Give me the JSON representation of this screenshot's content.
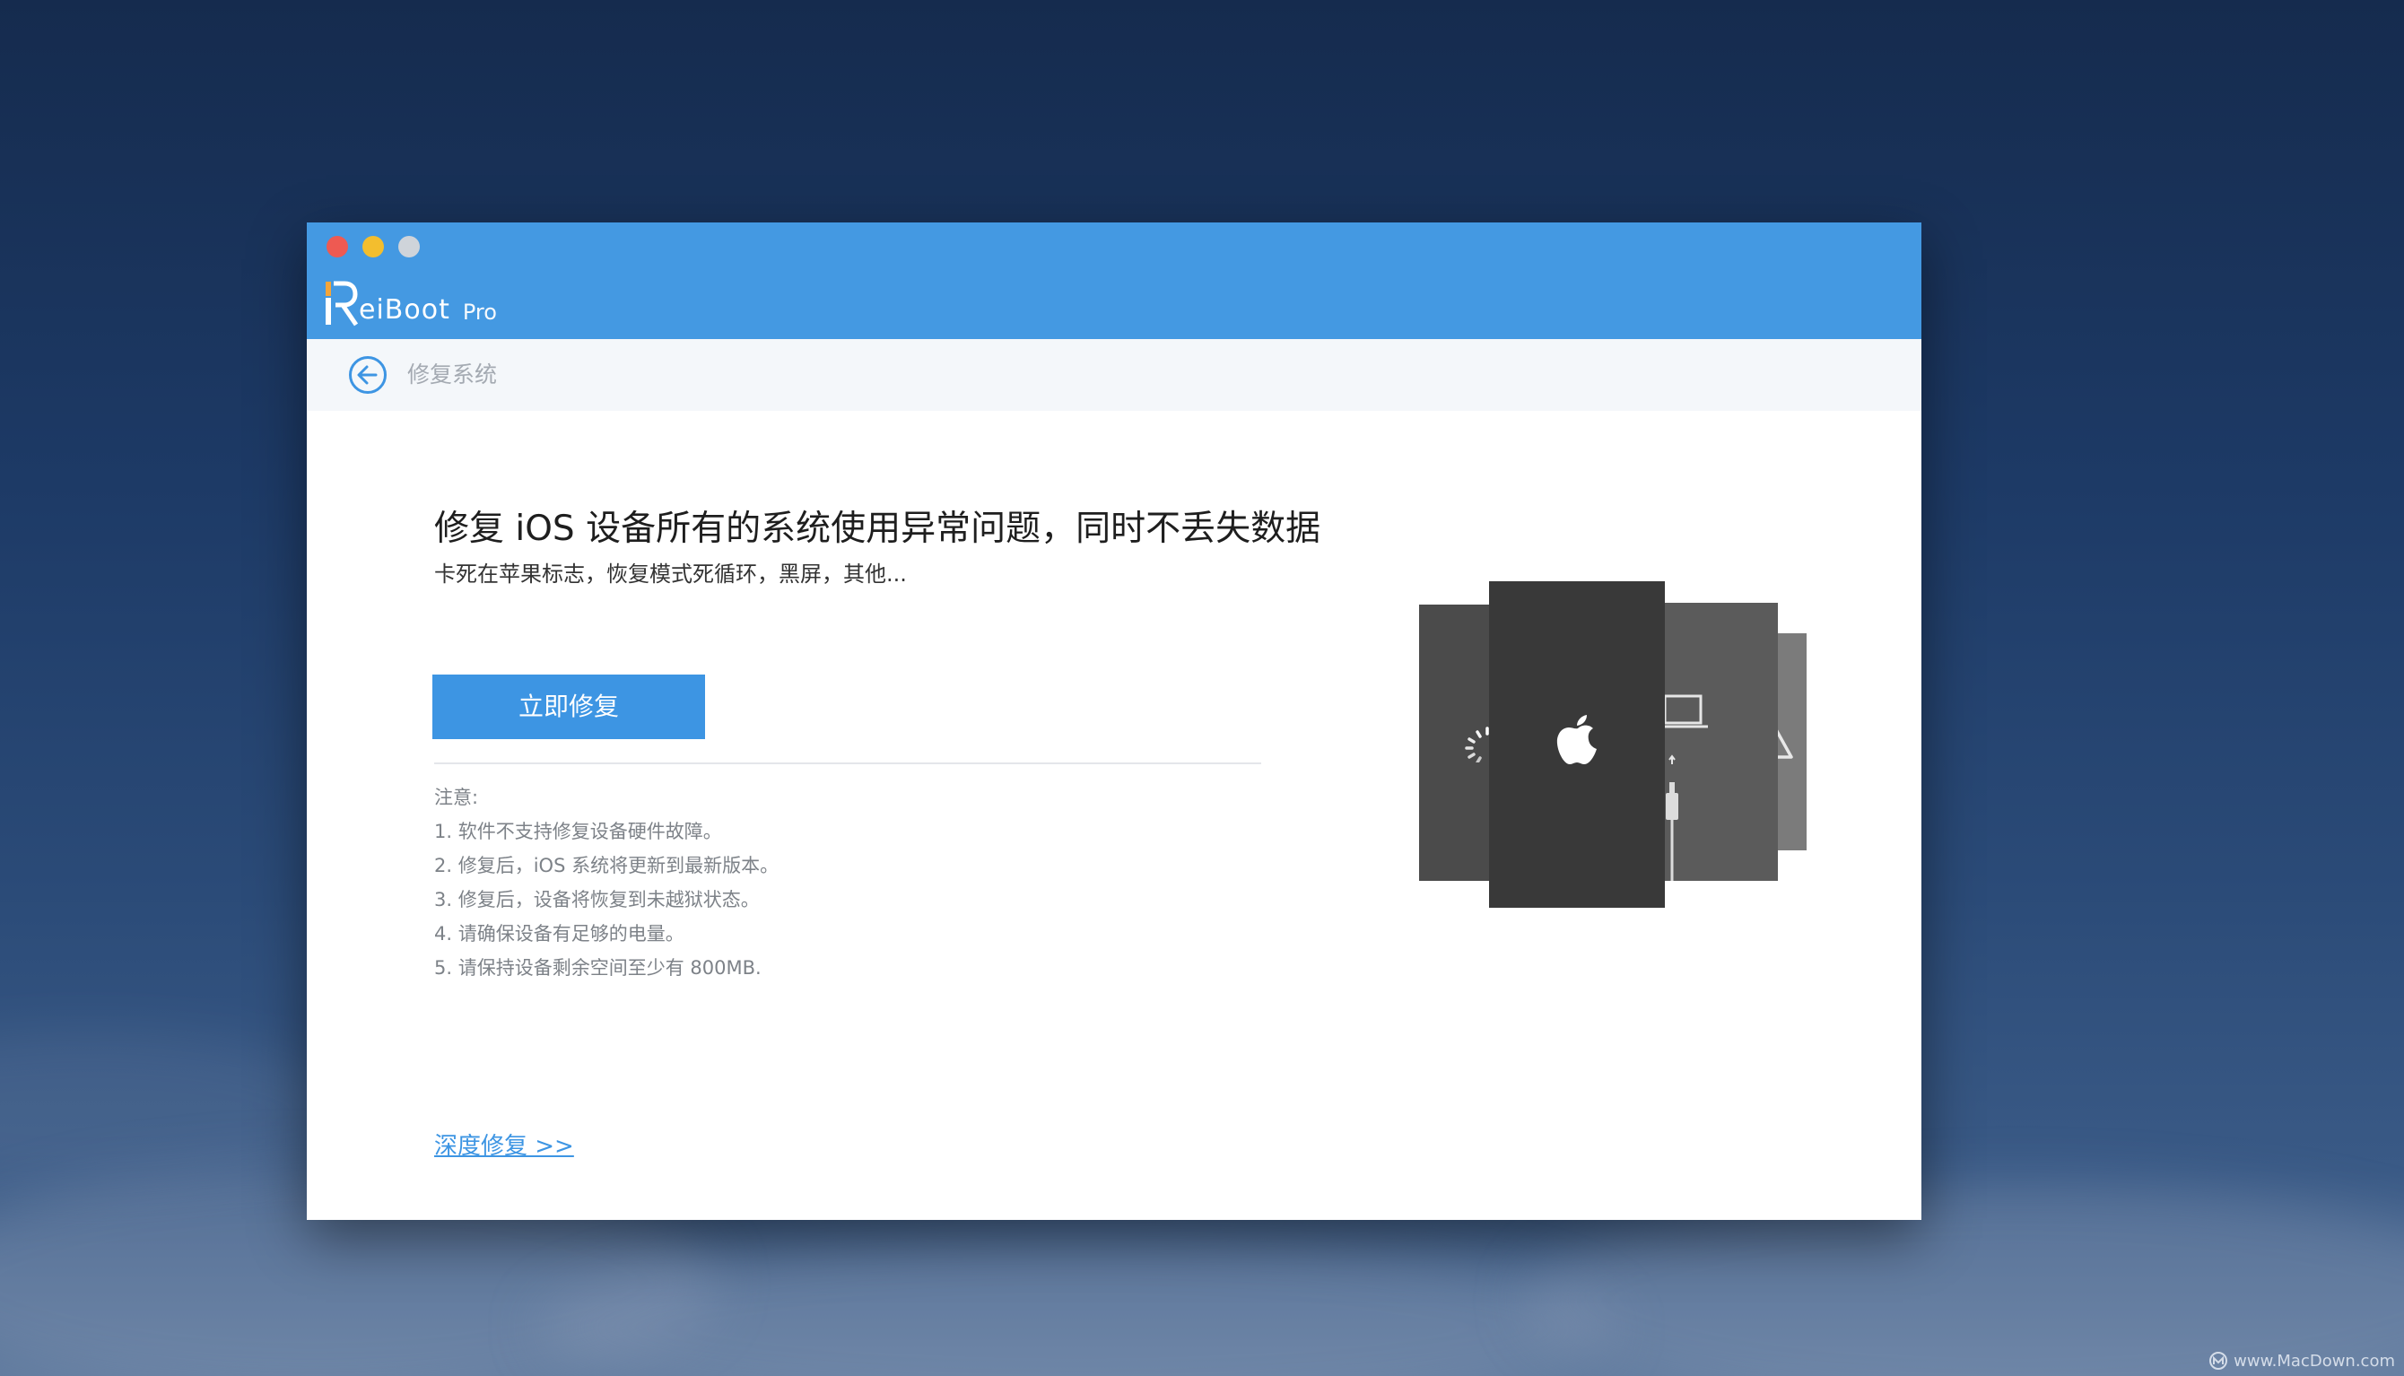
{
  "app": {
    "name": "eiBoot",
    "logo_letter": "R",
    "edition": "Pro"
  },
  "window_controls": [
    "close",
    "minimize",
    "maximize"
  ],
  "subbar": {
    "title": "修复系统",
    "back_icon": "back-arrow-icon"
  },
  "main": {
    "headline": "修复 iOS 设备所有的系统使用异常问题，同时不丢失数据",
    "subline": "卡死在苹果标志，恢复模式死循环，黑屏，其他...",
    "repair_button": "立即修复",
    "notes_title": "注意:",
    "notes": [
      "1. 软件不支持修复设备硬件故障。",
      "2. 修复后，iOS 系统将更新到最新版本。",
      "3. 修复后，设备将恢复到未越狱状态。",
      "4. 请确保设备有足够的电量。",
      "5. 请保持设备剩余空间至少有 800MB."
    ],
    "deep_repair_link": "深度修复 >>"
  },
  "illustration": {
    "panels": [
      "loading-spinner-icon",
      "apple-logo-icon",
      "laptop-cable-icon",
      "warning-icon"
    ]
  },
  "watermark": {
    "text": "www.MacDown.com"
  },
  "colors": {
    "titlebar": "#4499e2",
    "accent": "#3d95e3",
    "close": "#ee5a52",
    "minimize": "#f3be2e",
    "maximize": "#cfd4da"
  }
}
